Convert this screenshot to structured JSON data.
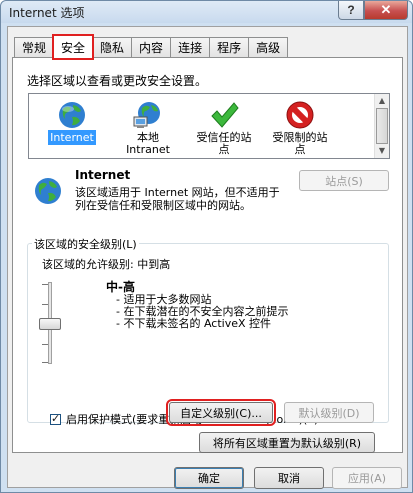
{
  "window": {
    "title": "Internet 选项",
    "help": "?",
    "close": "✕"
  },
  "tabs": [
    "常规",
    "安全",
    "隐私",
    "内容",
    "连接",
    "程序",
    "高级"
  ],
  "active_tab": 1,
  "zone_prompt": "选择区域以查看或更改安全设置。",
  "zones": [
    {
      "label": "Internet",
      "icon": "globe-icon",
      "selected": true
    },
    {
      "label": "本地\nIntranet",
      "icon": "intranet-globe-icon",
      "selected": false
    },
    {
      "label": "受信任的站\n点",
      "icon": "green-check-icon",
      "selected": false
    },
    {
      "label": "受限制的站\n点",
      "icon": "red-no-icon",
      "selected": false
    }
  ],
  "zone_info": {
    "name": "Internet",
    "description": "该区域适用于 Internet 网站，但不适用于列在受信任和受限制区域中的网站。",
    "sites_button": "站点(S)"
  },
  "security_level": {
    "group_title": "该区域的安全级别(L)",
    "allowed_levels": "该区域的允许级别: 中到高",
    "level": "中-高",
    "bullets": [
      "- 适用于大多数网站",
      "- 在下载潜在的不安全内容之前提示",
      "- 不下载未签名的 ActiveX 控件"
    ],
    "protected_mode": "启用保护模式(要求重新启动 Internet Explorer)(P)",
    "custom_button": "自定义级别(C)...",
    "default_button": "默认级别(D)",
    "reset_all_button": "将所有区域重置为默认级别(R)"
  },
  "footer": {
    "ok": "确定",
    "cancel": "取消",
    "apply": "应用(A)"
  },
  "colors": {
    "highlight_red": "#e02020",
    "selection_blue": "#3399ff"
  }
}
